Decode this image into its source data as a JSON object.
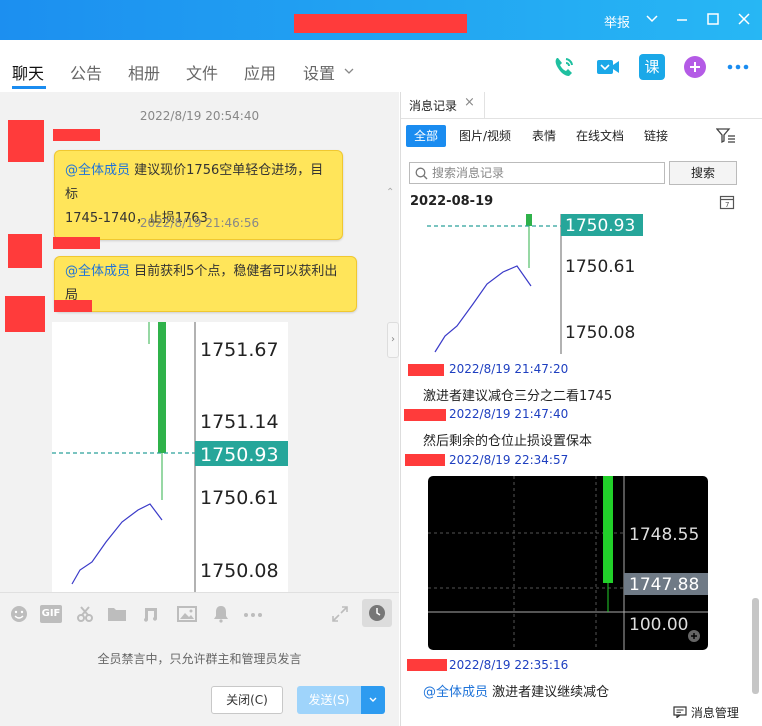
{
  "titlebar": {
    "report_label": "举报"
  },
  "tabs": [
    {
      "label": "聊天"
    },
    {
      "label": "公告"
    },
    {
      "label": "相册"
    },
    {
      "label": "文件"
    },
    {
      "label": "应用"
    },
    {
      "label": "设置"
    }
  ],
  "toolbar_icons": {
    "lesson_label": "课"
  },
  "chat": {
    "messages": [
      {
        "timestamp": "2022/8/19 20:54:40",
        "mention": "@全体成员",
        "text_line1": "建议现价1756空单轻仓进场，目标",
        "text_line2": "1745-1740，止损1763"
      },
      {
        "timestamp": "2022/8/19 21:46:56",
        "mention": "@全体成员",
        "text_line1": "目前获利5个点，稳健者可以获利出局"
      }
    ],
    "chart": {
      "tick_labels": [
        "1751.67",
        "1751.14",
        "1750.61",
        "1750.08"
      ],
      "current_price": "1750.93"
    }
  },
  "input": {
    "gif_label": "GIF",
    "muted_note": "全员禁言中，只允许群主和管理员发言",
    "close_button": "关闭(C)",
    "send_button": "发送(S)"
  },
  "history": {
    "tab_label": "消息记录",
    "filters": [
      "全部",
      "图片/视频",
      "表情",
      "在线文档",
      "链接"
    ],
    "search_placeholder": "搜索消息记录",
    "search_button": "搜索",
    "date": "2022-08-19",
    "chart1": {
      "current_price": "1750.93",
      "tick_labels": [
        "1750.61",
        "1750.08"
      ]
    },
    "entries": [
      {
        "time": "2022/8/19 21:47:20",
        "text": "激进者建议减仓三分之二看1745"
      },
      {
        "time": "2022/8/19 21:47:40",
        "text": "然后剩余的仓位止损设置保本"
      },
      {
        "time": "2022/8/19 22:34:57"
      },
      {
        "time": "2022/8/19 22:35:16",
        "mention": "@全体成员",
        "text": "激进者建议继续减仓"
      }
    ],
    "chart2": {
      "tick_label": "1748.55",
      "current_price": "1747.88",
      "volume_label": "100.00"
    },
    "footer": "消息管理"
  },
  "colors": {
    "accent": "#1a8cf0",
    "bubble": "#ffe55a",
    "redaction": "#ff3b3b",
    "candle_green": "#2fb24a"
  }
}
